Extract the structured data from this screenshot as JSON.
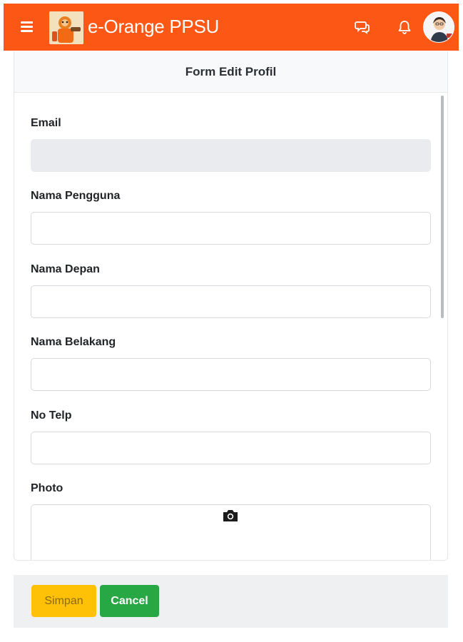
{
  "navbar": {
    "brand": "e-Orange PPSU",
    "color": "#fd5716",
    "icons": [
      "menu-icon",
      "chat-icon",
      "bell-icon"
    ]
  },
  "card": {
    "title": "Form Edit Profil"
  },
  "form": {
    "email": {
      "label": "Email",
      "value": ""
    },
    "username": {
      "label": "Nama Pengguna",
      "value": ""
    },
    "first_name": {
      "label": "Nama Depan",
      "value": ""
    },
    "last_name": {
      "label": "Nama Belakang",
      "value": ""
    },
    "phone": {
      "label": "No Telp",
      "value": ""
    },
    "photo": {
      "label": "Photo",
      "icon": "camera-icon"
    }
  },
  "footer": {
    "save_label": "Simpan",
    "cancel_label": "Cancel",
    "save_color": "#ffc107",
    "cancel_color": "#28a745"
  }
}
